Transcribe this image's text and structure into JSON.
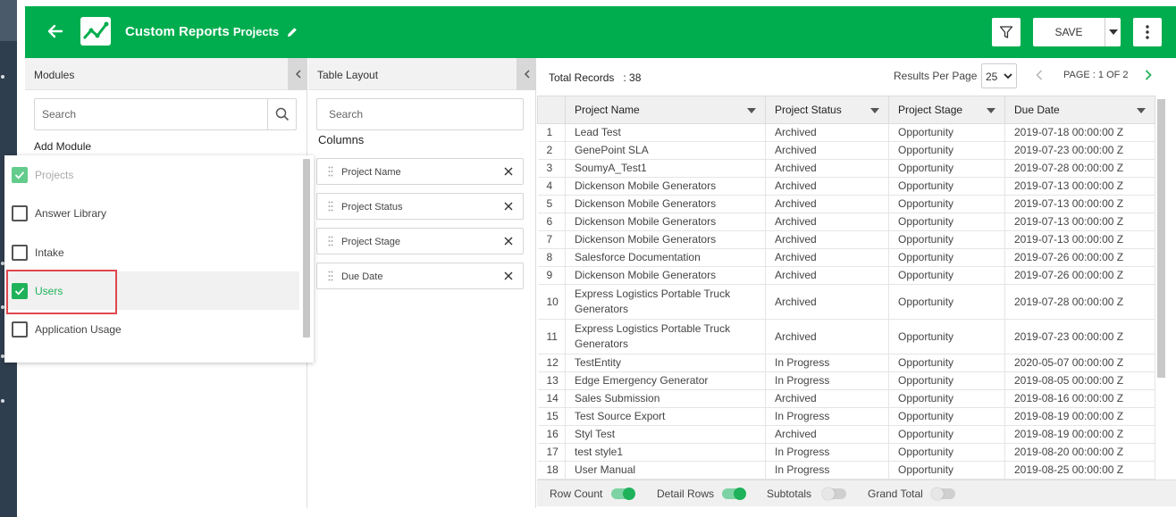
{
  "header": {
    "title": "Custom Reports",
    "subtitle": "Projects",
    "save_label": "SAVE"
  },
  "modules": {
    "heading": "Modules",
    "search_placeholder": "Search",
    "add_module_label": "Add Module",
    "items": [
      {
        "label": "Projects",
        "checked": true,
        "disabled": true
      },
      {
        "label": "Answer Library",
        "checked": false
      },
      {
        "label": "Intake",
        "checked": false
      },
      {
        "label": "Users",
        "checked": true,
        "highlighted": true
      },
      {
        "label": "Application Usage",
        "checked": false
      }
    ]
  },
  "layout": {
    "heading": "Table Layout",
    "search_placeholder": "Search",
    "columns_label": "Columns",
    "columns": [
      "Project Name",
      "Project Status",
      "Project Stage",
      "Due Date"
    ]
  },
  "results": {
    "total_label": "Total Records",
    "total_value": ": 38",
    "results_per_page_label": "Results Per Page",
    "results_per_page_value": "25",
    "page_label": "PAGE : 1 OF 2",
    "columns": [
      "Project Name",
      "Project Status",
      "Project Stage",
      "Due Date"
    ],
    "rows": [
      [
        "1",
        "Lead Test",
        "Archived",
        "Opportunity",
        "2019-07-18 00:00:00 Z"
      ],
      [
        "2",
        "GenePoint SLA",
        "Archived",
        "Opportunity",
        "2019-07-23 00:00:00 Z"
      ],
      [
        "3",
        "SoumyA_Test1",
        "Archived",
        "Opportunity",
        "2019-07-28 00:00:00 Z"
      ],
      [
        "4",
        "Dickenson Mobile Generators",
        "Archived",
        "Opportunity",
        "2019-07-13 00:00:00 Z"
      ],
      [
        "5",
        "Dickenson Mobile Generators",
        "Archived",
        "Opportunity",
        "2019-07-13 00:00:00 Z"
      ],
      [
        "6",
        "Dickenson Mobile Generators",
        "Archived",
        "Opportunity",
        "2019-07-13 00:00:00 Z"
      ],
      [
        "7",
        "Dickenson Mobile Generators",
        "Archived",
        "Opportunity",
        "2019-07-13 00:00:00 Z"
      ],
      [
        "8",
        "Salesforce Documentation",
        "Archived",
        "Opportunity",
        "2019-07-26 00:00:00 Z"
      ],
      [
        "9",
        "Dickenson Mobile Generators",
        "Archived",
        "Opportunity",
        "2019-07-26 00:00:00 Z"
      ],
      [
        "10",
        "Express Logistics Portable Truck Generators",
        "Archived",
        "Opportunity",
        "2019-07-28 00:00:00 Z"
      ],
      [
        "11",
        "Express Logistics Portable Truck Generators",
        "Archived",
        "Opportunity",
        "2019-07-23 00:00:00 Z"
      ],
      [
        "12",
        "TestEntity",
        "In Progress",
        "Opportunity",
        "2020-05-07 00:00:00 Z"
      ],
      [
        "13",
        "Edge Emergency Generator",
        "In Progress",
        "Opportunity",
        "2019-08-05 00:00:00 Z"
      ],
      [
        "14",
        "Sales Submission",
        "Archived",
        "Opportunity",
        "2019-08-16 00:00:00 Z"
      ],
      [
        "15",
        "Test Source Export",
        "In Progress",
        "Opportunity",
        "2019-08-19 00:00:00 Z"
      ],
      [
        "16",
        "Styl Test",
        "Archived",
        "Opportunity",
        "2019-08-19 00:00:00 Z"
      ],
      [
        "17",
        "test style1",
        "In Progress",
        "Opportunity",
        "2019-08-20 00:00:00 Z"
      ],
      [
        "18",
        "User Manual",
        "In Progress",
        "Opportunity",
        "2019-08-25 00:00:00 Z"
      ]
    ]
  },
  "footer": {
    "toggles": [
      {
        "label": "Row Count",
        "on": true
      },
      {
        "label": "Detail Rows",
        "on": true
      },
      {
        "label": "Subtotals",
        "on": false
      },
      {
        "label": "Grand Total",
        "on": false
      }
    ]
  },
  "colors": {
    "brand_green": "#00ad4e",
    "check_green": "#1fb25a",
    "highlight_red": "#e0474c"
  }
}
